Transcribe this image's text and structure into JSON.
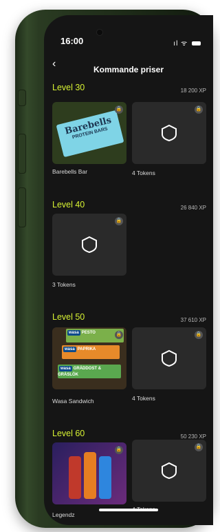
{
  "status_bar": {
    "time": "16:00",
    "signal": "ıl",
    "wifi": "ᯤ"
  },
  "header": {
    "back_icon": "‹",
    "title": "Kommande priser"
  },
  "sections": [
    {
      "level": "Level 30",
      "xp": "18 200 XP",
      "items": [
        {
          "label": "Barebells Bar",
          "image": "barebells-protein-bar"
        },
        {
          "label": "4 Tokens",
          "image": "shield-icon"
        }
      ]
    },
    {
      "level": "Level 40",
      "xp": "26 840 XP",
      "items": [
        {
          "label": "3 Tokens",
          "image": "shield-icon"
        }
      ]
    },
    {
      "level": "Level 50",
      "xp": "37 610 XP",
      "items": [
        {
          "label": "Wasa Sandwich",
          "image": "wasa-sandwich"
        },
        {
          "label": "4 Tokens",
          "image": "shield-icon"
        }
      ]
    },
    {
      "level": "Level 60",
      "xp": "50 230 XP",
      "items": [
        {
          "label": "Legendz",
          "image": "legendz-cans"
        },
        {
          "label": "4 Tokens",
          "image": "shield-icon"
        }
      ]
    }
  ],
  "product_text": {
    "barebells_brand": "Barebells",
    "barebells_sub": "PROTEIN BARS",
    "wasa_logo": "wasa",
    "wasa_pack_1": "PESTO",
    "wasa_pack_2": "PAPRIKA",
    "wasa_pack_3": "GRÄDDOST & GRÄSLÖK"
  },
  "colors": {
    "accent": "#d7f233",
    "background": "#151515",
    "card": "#2a2a2a"
  }
}
